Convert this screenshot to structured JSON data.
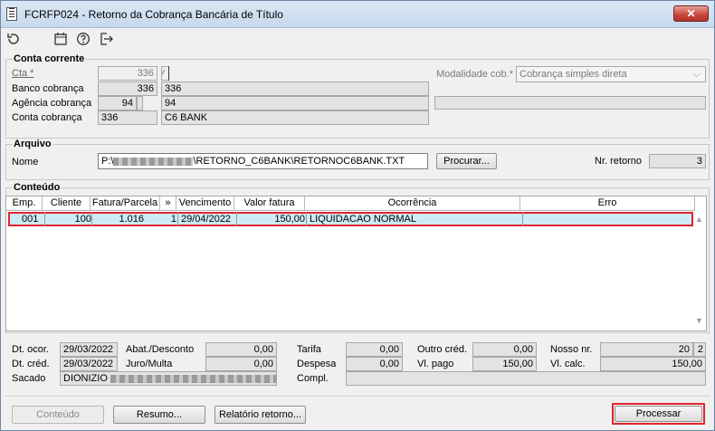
{
  "window": {
    "title": "FCRFP024 - Retorno da Cobrança Bancária de Título",
    "close": "✕"
  },
  "toolbar": [
    "refresh-icon",
    "calendar-icon",
    "help-icon",
    "exit-icon"
  ],
  "conta": {
    "title": "Conta corrente",
    "cta_label": "Cta *",
    "cta_value": "336",
    "banco_label": "Banco cobrança",
    "banco_code": "336",
    "banco_name": "336",
    "agencia_label": "Agência cobrança",
    "agencia_code": "94",
    "agencia_name": "94",
    "conta_label": "Conta cobrança",
    "conta_code": "336",
    "conta_name": "C6 BANK",
    "modalidade_label": "Modalidade cob.*",
    "modalidade_value": "Cobrança simples direta"
  },
  "arquivo": {
    "title": "Arquivo",
    "nome_label": "Nome",
    "nome_prefix": "P:\\",
    "nome_suffix": "\\RETORNO_C6BANK\\RETORNOC6BANK.TXT",
    "procurar": "Procurar...",
    "nr_label": "Nr. retorno",
    "nr_value": "3"
  },
  "conteudo": {
    "title": "Conteúdo",
    "columns": [
      "Emp.",
      "Cliente",
      "Fatura/Parcela",
      "»",
      "Vencimento",
      "Valor fatura",
      "Ocorrência",
      "Erro"
    ],
    "rows": [
      {
        "emp": "001",
        "cliente": "100",
        "fatura": "1.016",
        "parcela": "1",
        "vencimento": "29/04/2022",
        "valor": "150,00",
        "ocorrencia": "LIQUIDACAO NORMAL",
        "erro": ""
      }
    ]
  },
  "details": {
    "dt_ocor_label": "Dt. ocor.",
    "dt_ocor": "29/03/2022",
    "dt_cred_label": "Dt. créd.",
    "dt_cred": "29/03/2022",
    "sacado_label": "Sacado",
    "sacado": "DIONIZIO",
    "abat_label": "Abat./Desconto",
    "abat": "0,00",
    "juro_label": "Juro/Multa",
    "juro": "0,00",
    "tarifa_label": "Tarifa",
    "tarifa": "0,00",
    "despesa_label": "Despesa",
    "despesa": "0,00",
    "compl_label": "Compl.",
    "outro_label": "Outro créd.",
    "outro": "0,00",
    "vlpago_label": "Vl. pago",
    "vlpago": "150,00",
    "nosso_label": "Nosso nr.",
    "nosso": "20",
    "nosso_dv": "2",
    "vlcalc_label": "Vl. calc.",
    "vlcalc": "150,00"
  },
  "buttons": {
    "conteudo": "Conteúdo",
    "resumo": "Resumo...",
    "relatorio": "Relatório retorno...",
    "processar": "Processar"
  }
}
